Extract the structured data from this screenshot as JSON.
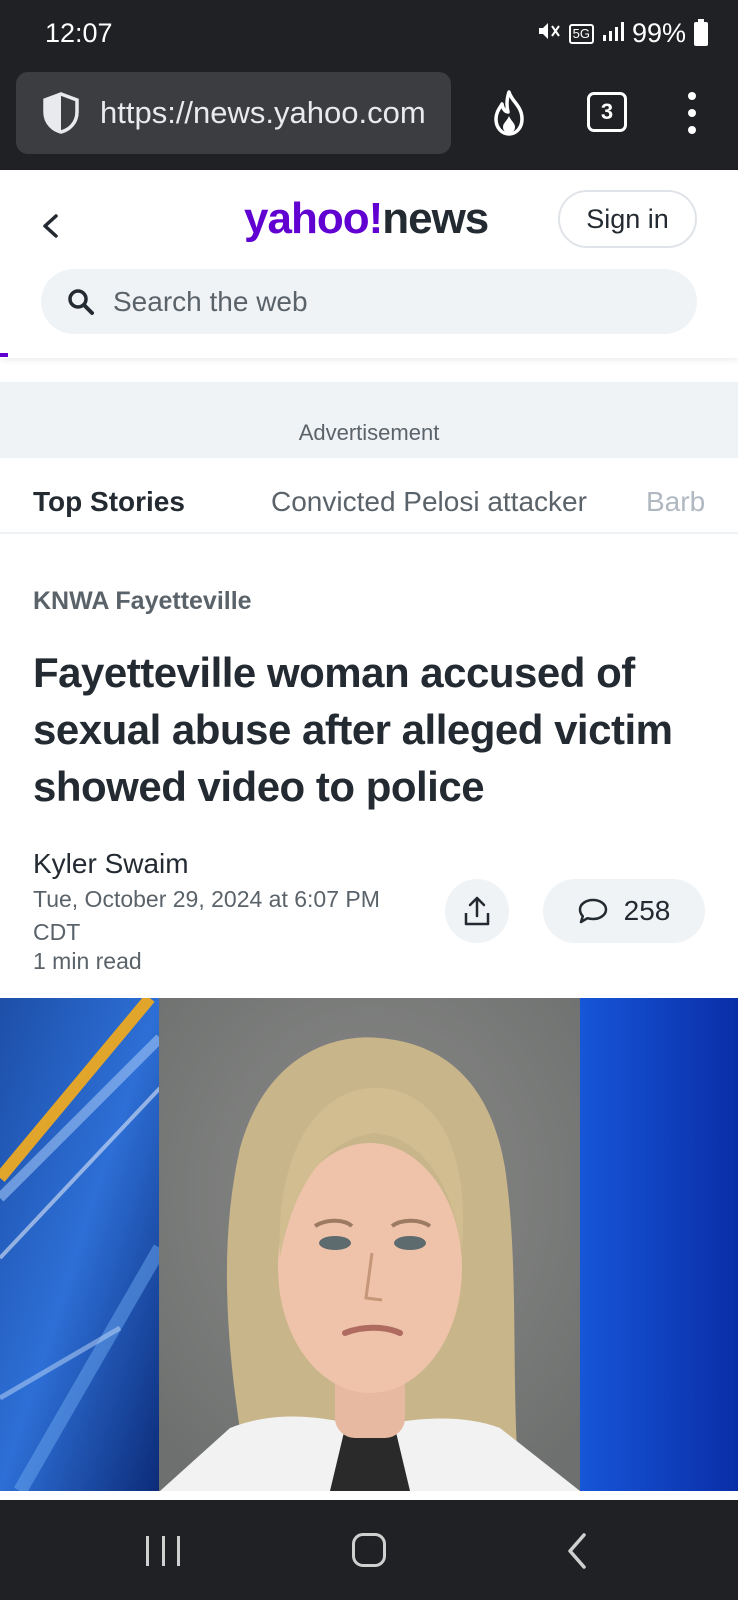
{
  "status_bar": {
    "time": "12:07",
    "network": "5G",
    "battery": "99%",
    "icons": [
      "mute-icon",
      "network-5g-icon",
      "signal-icon",
      "battery-icon"
    ]
  },
  "browser": {
    "url": "https://news.yahoo.com",
    "tab_count": "3",
    "icons": [
      "shield-icon",
      "fire-icon",
      "menu-dots-icon"
    ]
  },
  "header": {
    "logo_yahoo": "yahoo!",
    "logo_news": "news",
    "sign_in_label": "Sign in",
    "search_placeholder": "Search the web"
  },
  "ad": {
    "label": "Advertisement"
  },
  "stories_nav": {
    "items": [
      "Top Stories",
      "Convicted Pelosi attacker",
      "Barb"
    ]
  },
  "article": {
    "source": "KNWA Fayetteville",
    "headline": "Fayetteville woman accused of sexual abuse after alleged victim showed video to police",
    "author": "Kyler Swaim",
    "date": "Tue, October 29, 2024 at 6:07 PM CDT",
    "read_time": "1 min read",
    "comment_count": "258"
  },
  "colors": {
    "yahoo_purple": "#6001d2",
    "text_dark": "#232a31",
    "text_gray": "#5b636a",
    "chrome_dark": "#202124"
  }
}
